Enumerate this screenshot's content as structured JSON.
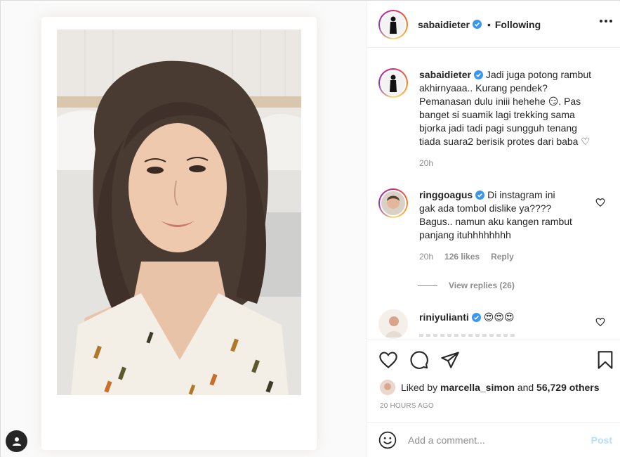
{
  "post": {
    "author": "sabaidieter",
    "follow_dot": "•",
    "follow_status": "Following"
  },
  "caption": {
    "username": "sabaidieter",
    "text": "Jadi juga potong rambut akhirnyaaa.. Kurang pendek? Pemanasan dulu iniii hehehe 😏. Pas banget si suamik lagi trekking sama bjorka jadi tadi pagi sungguh tenang tiada suara2 berisik protes dari baba ♡",
    "time": "20h"
  },
  "comments": [
    {
      "username": "ringgoagus",
      "text": "Di instagram ini gak ada tombol dislike ya???? Bagus.. namun aku kangen rambut panjang ituhhhhhhhh",
      "time": "20h",
      "likes": "126 likes",
      "reply": "Reply"
    },
    {
      "username": "riniyulianti",
      "text": "😍😍😍"
    }
  ],
  "view_replies": "View replies (26)",
  "liked_by": {
    "prefix": "Liked by",
    "user": "marcella_simon",
    "and": "and",
    "count": "56,729 others"
  },
  "posted_time": "20 HOURS AGO",
  "comment_box": {
    "placeholder": "Add a comment...",
    "post_label": "Post"
  },
  "colors": {
    "verified": "#3897f0",
    "post_disabled": "#b2dffc",
    "muted": "#8e8e8e"
  },
  "icons": [
    "more-options-icon",
    "heart-icon",
    "comment-icon",
    "share-icon",
    "bookmark-icon",
    "emoji-icon",
    "user-tag-icon",
    "verified-badge-icon"
  ]
}
